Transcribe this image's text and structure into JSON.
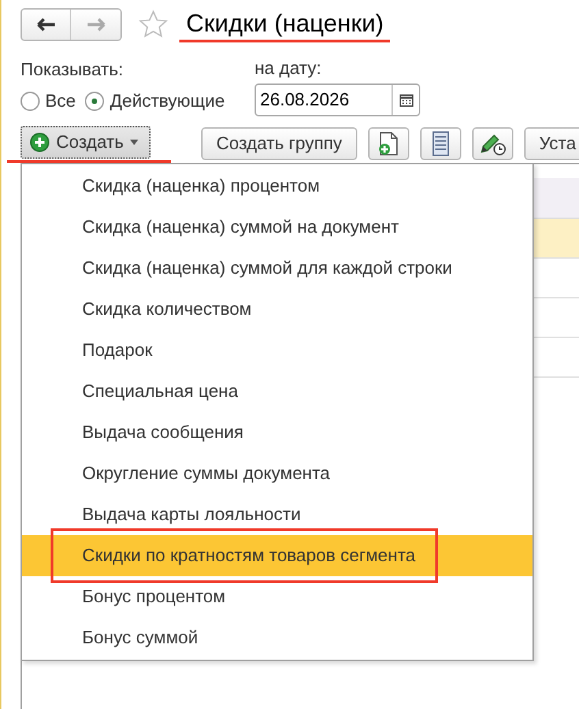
{
  "title": {
    "text": "Скидки (наценки)",
    "underlined": true,
    "favorite": false
  },
  "filter": {
    "label": "Показывать:",
    "options": [
      {
        "label": "Все",
        "selected": false
      },
      {
        "label": "Действующие",
        "selected": true
      }
    ]
  },
  "date": {
    "label": "на дату:",
    "value": "26.08.2026"
  },
  "toolbar": [
    {
      "kind": "dropdown",
      "label": "Создать",
      "focused": true,
      "underlined": true
    },
    {
      "kind": "text",
      "label": "Создать группу"
    },
    {
      "kind": "icon"
    },
    {
      "kind": "icon"
    },
    {
      "kind": "icon"
    },
    {
      "kind": "text",
      "label": "Уста"
    }
  ],
  "table": {
    "rows": [
      {
        "selected": true
      },
      {
        "selected": false
      },
      {
        "selected": false
      },
      {
        "selected": false
      }
    ]
  },
  "menu": [
    {
      "label": "Скидка (наценка) процентом",
      "selected": false,
      "outlined": false
    },
    {
      "label": "Скидка (наценка) суммой на документ",
      "selected": false,
      "outlined": false
    },
    {
      "label": "Скидка (наценка) суммой для каждой строки",
      "selected": false,
      "outlined": false
    },
    {
      "label": "Скидка количеством",
      "selected": false,
      "outlined": false
    },
    {
      "label": "Подарок",
      "selected": false,
      "outlined": false
    },
    {
      "label": "Специальная цена",
      "selected": false,
      "outlined": false
    },
    {
      "label": "Выдача сообщения",
      "selected": false,
      "outlined": false
    },
    {
      "label": "Округление суммы документа",
      "selected": false,
      "outlined": false
    },
    {
      "label": "Выдача карты лояльности",
      "selected": false,
      "outlined": false
    },
    {
      "label": "Скидки по кратностям товаров сегмента",
      "selected": true,
      "outlined": true
    },
    {
      "label": "Бонус процентом",
      "selected": false,
      "outlined": false
    },
    {
      "label": "Бонус суммой",
      "selected": false,
      "outlined": false
    }
  ]
}
